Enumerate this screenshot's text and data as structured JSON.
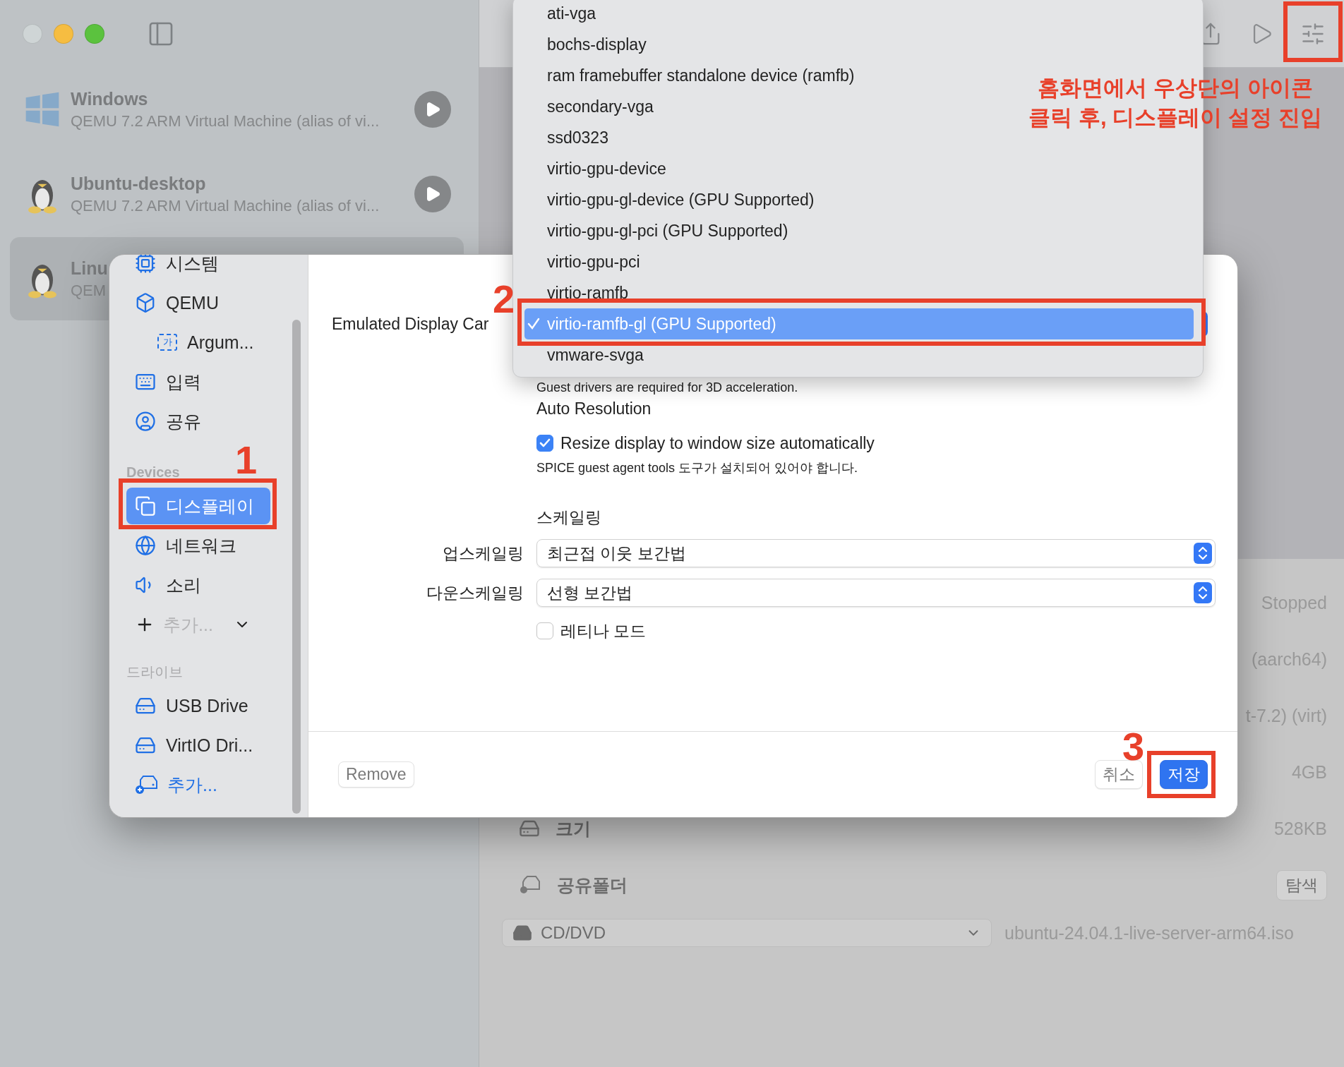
{
  "vm_list": [
    {
      "kind": "windows",
      "name": "Windows",
      "description": "QEMU 7.2 ARM Virtual Machine (alias of vi...",
      "selected": false
    },
    {
      "kind": "linux",
      "name": "Ubuntu-desktop",
      "description": "QEMU 7.2 ARM Virtual Machine (alias of vi...",
      "selected": false
    },
    {
      "kind": "linux",
      "name": "Linu",
      "description": "QEM",
      "selected": true
    }
  ],
  "details": {
    "rows": [
      {
        "value": "Stopped"
      },
      {
        "value": "(aarch64)"
      },
      {
        "value": "t-7.2) (virt)"
      },
      {
        "value": "4GB"
      },
      {
        "label": "크기",
        "value": "528KB"
      },
      {
        "label": "공유폴더",
        "button": "탐색"
      }
    ],
    "cd_drive": {
      "label": "CD/DVD",
      "file": "ubuntu-24.04.1-live-server-arm64.iso"
    }
  },
  "settings": {
    "sidebar": {
      "sections": [
        {
          "items": [
            {
              "label": "시스템",
              "selected": false
            },
            {
              "label": "QEMU",
              "selected": false,
              "children": [
                {
                  "label": "Argum...",
                  "icon_text": "가",
                  "selected": false
                }
              ]
            },
            {
              "label": "입력",
              "selected": false
            },
            {
              "label": "공유",
              "selected": false
            }
          ]
        },
        {
          "header": "Devices",
          "items": [
            {
              "label": "디스플레이",
              "selected": true
            },
            {
              "label": "네트워크",
              "selected": false
            },
            {
              "label": "소리",
              "selected": false
            }
          ],
          "add": {
            "kind": "menu",
            "label": "추가..."
          }
        },
        {
          "header": "드라이브",
          "items": [
            {
              "label": "USB Drive",
              "selected": false
            },
            {
              "label": "VirtIO Dri...",
              "selected": false
            }
          ],
          "add": {
            "kind": "link",
            "label": "추가..."
          }
        }
      ]
    },
    "display_card_label": "Emulated Display Car",
    "note": "Guest drivers are required for 3D acceleration.",
    "auto_resolution": {
      "title": "Auto Resolution",
      "checkbox_label": "Resize display to window size automatically",
      "checked": true,
      "hint": "SPICE guest agent tools 도구가 설치되어 있어야 합니다."
    },
    "scaling": {
      "title": "스케일링",
      "rows": [
        {
          "label": "업스케일링",
          "value": "최근접 이웃 보간법"
        },
        {
          "label": "다운스케일링",
          "value": "선형 보간법"
        }
      ]
    },
    "retina": {
      "label": "레티나 모드",
      "checked": false
    },
    "buttons": {
      "remove": "Remove",
      "cancel": "취소",
      "save": "저장"
    }
  },
  "display_menu": {
    "options": [
      {
        "label": "ati-vga",
        "selected": false
      },
      {
        "label": "bochs-display",
        "selected": false
      },
      {
        "label": "ram framebuffer standalone device (ramfb)",
        "selected": false
      },
      {
        "label": "secondary-vga",
        "selected": false
      },
      {
        "label": "ssd0323",
        "selected": false
      },
      {
        "label": "virtio-gpu-device",
        "selected": false
      },
      {
        "label": "virtio-gpu-gl-device (GPU Supported)",
        "selected": false
      },
      {
        "label": "virtio-gpu-gl-pci (GPU Supported)",
        "selected": false
      },
      {
        "label": "virtio-gpu-pci",
        "selected": false
      },
      {
        "label": "virtio-ramfb",
        "selected": false
      },
      {
        "label": "virtio-ramfb-gl (GPU Supported)",
        "selected": true
      },
      {
        "label": "vmware-svga",
        "selected": false
      }
    ]
  },
  "annotations": {
    "note": [
      "홈화면에서 우상단의 아이콘",
      "클릭 후, 디스플레이 설정 진입"
    ],
    "steps": [
      "1",
      "2",
      "3"
    ]
  }
}
